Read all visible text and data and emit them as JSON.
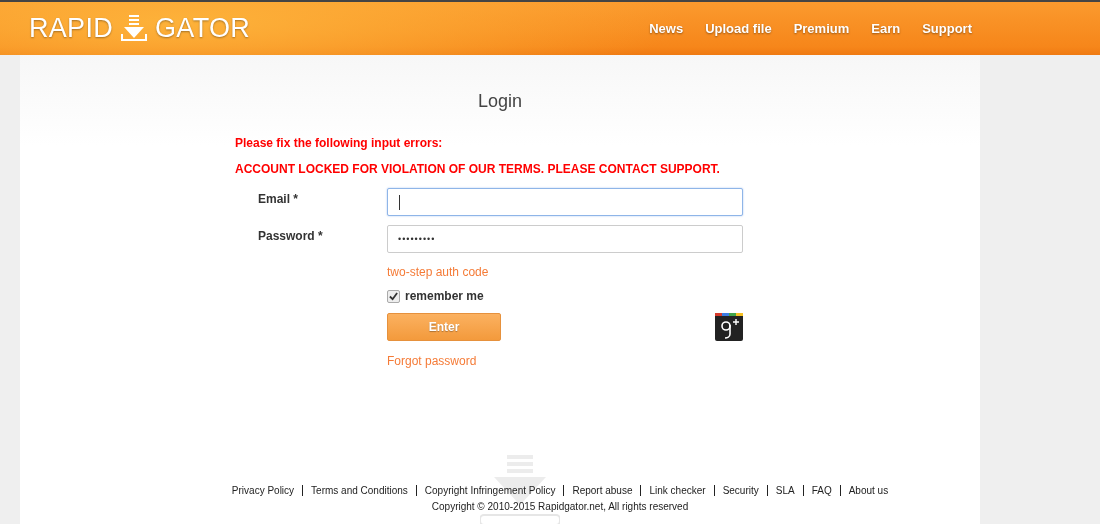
{
  "header": {
    "logo": {
      "left": "RAPID",
      "right": "GATOR"
    },
    "nav": [
      "News",
      "Upload file",
      "Premium",
      "Earn",
      "Support"
    ]
  },
  "login": {
    "title": "Login",
    "errors": {
      "heading": "Please fix the following input errors:",
      "message": "ACCOUNT LOCKED FOR VIOLATION OF OUR TERMS. PLEASE CONTACT SUPPORT."
    },
    "fields": [
      {
        "label": "Email *",
        "kind": "text",
        "focused": true
      },
      {
        "label": "Password *",
        "kind": "password",
        "value": "•••••••••",
        "focused": false
      }
    ],
    "two_step_link": "two-step auth code",
    "remember": {
      "label": "remember me",
      "checked": true
    },
    "submit": "Enter",
    "forgot_link": "Forgot password"
  },
  "footer": {
    "links": [
      "Privacy Policy",
      "Terms and Conditions",
      "Copyright Infringement Policy",
      "Report abuse",
      "Link checker",
      "Security",
      "SLA",
      "FAQ",
      "About us"
    ],
    "copyright": "Copyright © 2010-2015 Rapidgator.net, All rights reserved"
  }
}
